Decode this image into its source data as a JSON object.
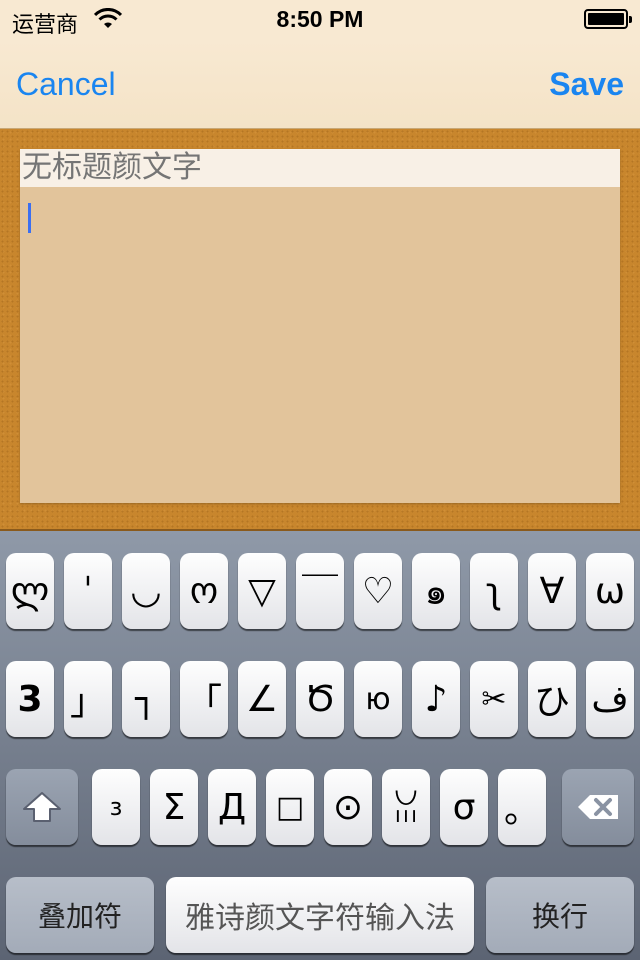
{
  "status": {
    "carrier": "运营商",
    "time": "8:50 PM"
  },
  "nav": {
    "cancel": "Cancel",
    "save": "Save"
  },
  "editor": {
    "title_placeholder": "无标题颜文字"
  },
  "keyboard": {
    "row1": [
      "ლ",
      "ˈ",
      "◡",
      "ო",
      "▽",
      "￣",
      "♡",
      "๑",
      "ʅ",
      "∀",
      "ω"
    ],
    "row2": [
      "3",
      "」",
      "┐",
      "「",
      "∠",
      "Ծ",
      "ю",
      "♪",
      "✂",
      "ひ",
      "ف"
    ],
    "row3": [
      "з",
      "Σ",
      "Д",
      "□",
      "⊙",
      "ꈍ",
      "σ",
      "。"
    ],
    "overlay_label": "叠加符",
    "space_label": "雅诗颜文字符输入法",
    "return_label": "换行",
    "shift_icon": "shift-arrow-icon",
    "delete_icon": "backspace-icon"
  }
}
